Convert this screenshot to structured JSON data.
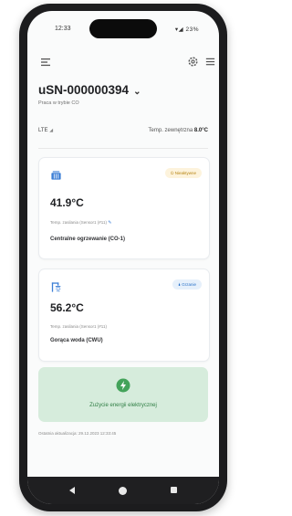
{
  "status_bar": {
    "time": "12:33",
    "icons": "▾◢ 23%"
  },
  "header": {
    "menu_icon": "menu-icon",
    "settings_icon": "gear-icon",
    "list_icon": "list-icon"
  },
  "device": {
    "title": "uSN-000000394",
    "dropdown_icon": "chevron-down-icon",
    "subtitle": "Praca w trybie CO"
  },
  "network": {
    "label": "LTE",
    "outdoor_label": "Temp. zewnętrzna",
    "outdoor_value": "8.0°C"
  },
  "heating_card": {
    "icon": "radiator-icon",
    "badge": "Nieaktywne",
    "temperature": "41.9°C",
    "temp_label": "Temp. zasilania (Sensor1 (#11)",
    "name": "Centralne ogrzewanie (CO-1)"
  },
  "hot_water_card": {
    "icon": "shower-icon",
    "badge": "Grzanie",
    "temperature": "56.2°C",
    "temp_label": "Temp. zasilania (Sensor1 (#11)",
    "name": "Gorąca woda (CWU)"
  },
  "energy": {
    "icon": "lightning-icon",
    "label": "Zużycie energii elektrycznej"
  },
  "footer": {
    "updated": "Ostatnia aktualizacja: 29.12.2023 12:33:45"
  },
  "navigation": {
    "back_icon": "back-triangle-icon",
    "home_icon": "home-circle-icon",
    "recent_icon": "recent-square-icon"
  },
  "colors": {
    "standby_badge": "#b68412",
    "active_badge": "#2b72c8",
    "accent_blue": "#3d7fd6",
    "energy_card": "#d6ecdc",
    "energy_text": "#2e7d43"
  }
}
